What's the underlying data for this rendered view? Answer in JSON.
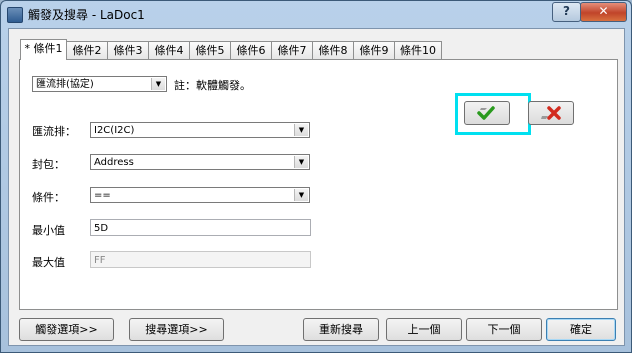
{
  "window": {
    "title": "觸發及搜尋 - LaDoc1"
  },
  "titlebar": {
    "help_label": "?",
    "close_label": "✕"
  },
  "tabs": [
    {
      "label": "* 條件1"
    },
    {
      "label": "條件2"
    },
    {
      "label": "條件3"
    },
    {
      "label": "條件4"
    },
    {
      "label": "條件5"
    },
    {
      "label": "條件6"
    },
    {
      "label": "條件7"
    },
    {
      "label": "條件8"
    },
    {
      "label": "條件9"
    },
    {
      "label": "條件10"
    }
  ],
  "condition": {
    "mode_select": "匯流排(協定)",
    "note": "註：軟體觸發。",
    "bus_label": "匯流排：",
    "bus_value": "I2C(I2C)",
    "packet_label": "封包：",
    "packet_value": "Address",
    "cond_label": "條件：",
    "cond_value": "==",
    "min_label": "最小值",
    "min_value": "5D",
    "max_label": "最大值",
    "max_value": "FF"
  },
  "buttons": {
    "trigger_options": "觸發選項>>",
    "search_options": "搜尋選項>>",
    "re_search": "重新搜尋",
    "prev": "上一個",
    "next": "下一個",
    "ok": "確定"
  },
  "icons": {
    "apply": "check-icon",
    "clear": "red-x-icon"
  }
}
